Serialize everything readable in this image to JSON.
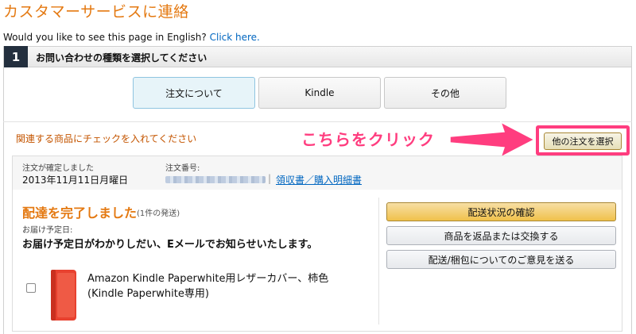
{
  "page": {
    "title": "カスタマーサービスに連絡",
    "english_prompt": "Would you like to see this page in English?",
    "english_link": "Click here."
  },
  "step": {
    "number": "1",
    "title": "お問い合わせの種類を選択してください"
  },
  "categories": [
    {
      "label": "注文について",
      "selected": true
    },
    {
      "label": "Kindle",
      "selected": false
    },
    {
      "label": "その他",
      "selected": false
    }
  ],
  "order_section": {
    "hint": "関連する商品にチェックを入れてください",
    "callout": "こちらをクリック",
    "other_order_button": "他の注文を選択"
  },
  "order": {
    "placed_label": "注文が確定しました",
    "placed_value": "2013年11月11日月曜日",
    "number_label": "注文番号:",
    "separator": "|",
    "receipt_link": "領収書／購入明細書",
    "status_title": "配達を完了しました",
    "shipment_count": "(1件の発送)",
    "eta_label": "お届け予定日:",
    "eta_value": "お届け予定日がわかりしだい、Eメールでお知らせいたします。",
    "actions": [
      {
        "label": "配送状況の確認",
        "style": "primary"
      },
      {
        "label": "商品を返品または交換する",
        "style": "secondary"
      },
      {
        "label": "配送/梱包についてのご意見を送る",
        "style": "secondary"
      }
    ],
    "item": {
      "title": "Amazon Kindle Paperwhite用レザーカバー、柿色 (Kindle Paperwhite専用)",
      "color": "#e8412f"
    }
  },
  "colors": {
    "brand_orange": "#e47911",
    "link_blue": "#0066c0",
    "callout_pink": "#ff3d7f",
    "step_badge": "#232f3e"
  }
}
